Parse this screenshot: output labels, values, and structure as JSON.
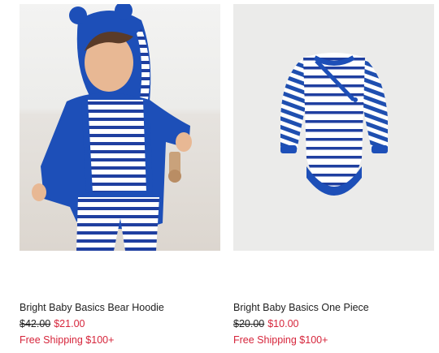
{
  "products": [
    {
      "name": "Bright Baby Basics Bear Hoodie",
      "original_price": "$42.00",
      "sale_price": "$21.00",
      "promo": "Free Shipping $100+"
    },
    {
      "name": "Bright Baby Basics One Piece",
      "original_price": "$20.00",
      "sale_price": "$10.00",
      "promo": "Free Shipping $100+"
    }
  ],
  "colors": {
    "accent_red": "#d6253b",
    "royal_blue": "#1d4fb8",
    "text": "#222222"
  }
}
